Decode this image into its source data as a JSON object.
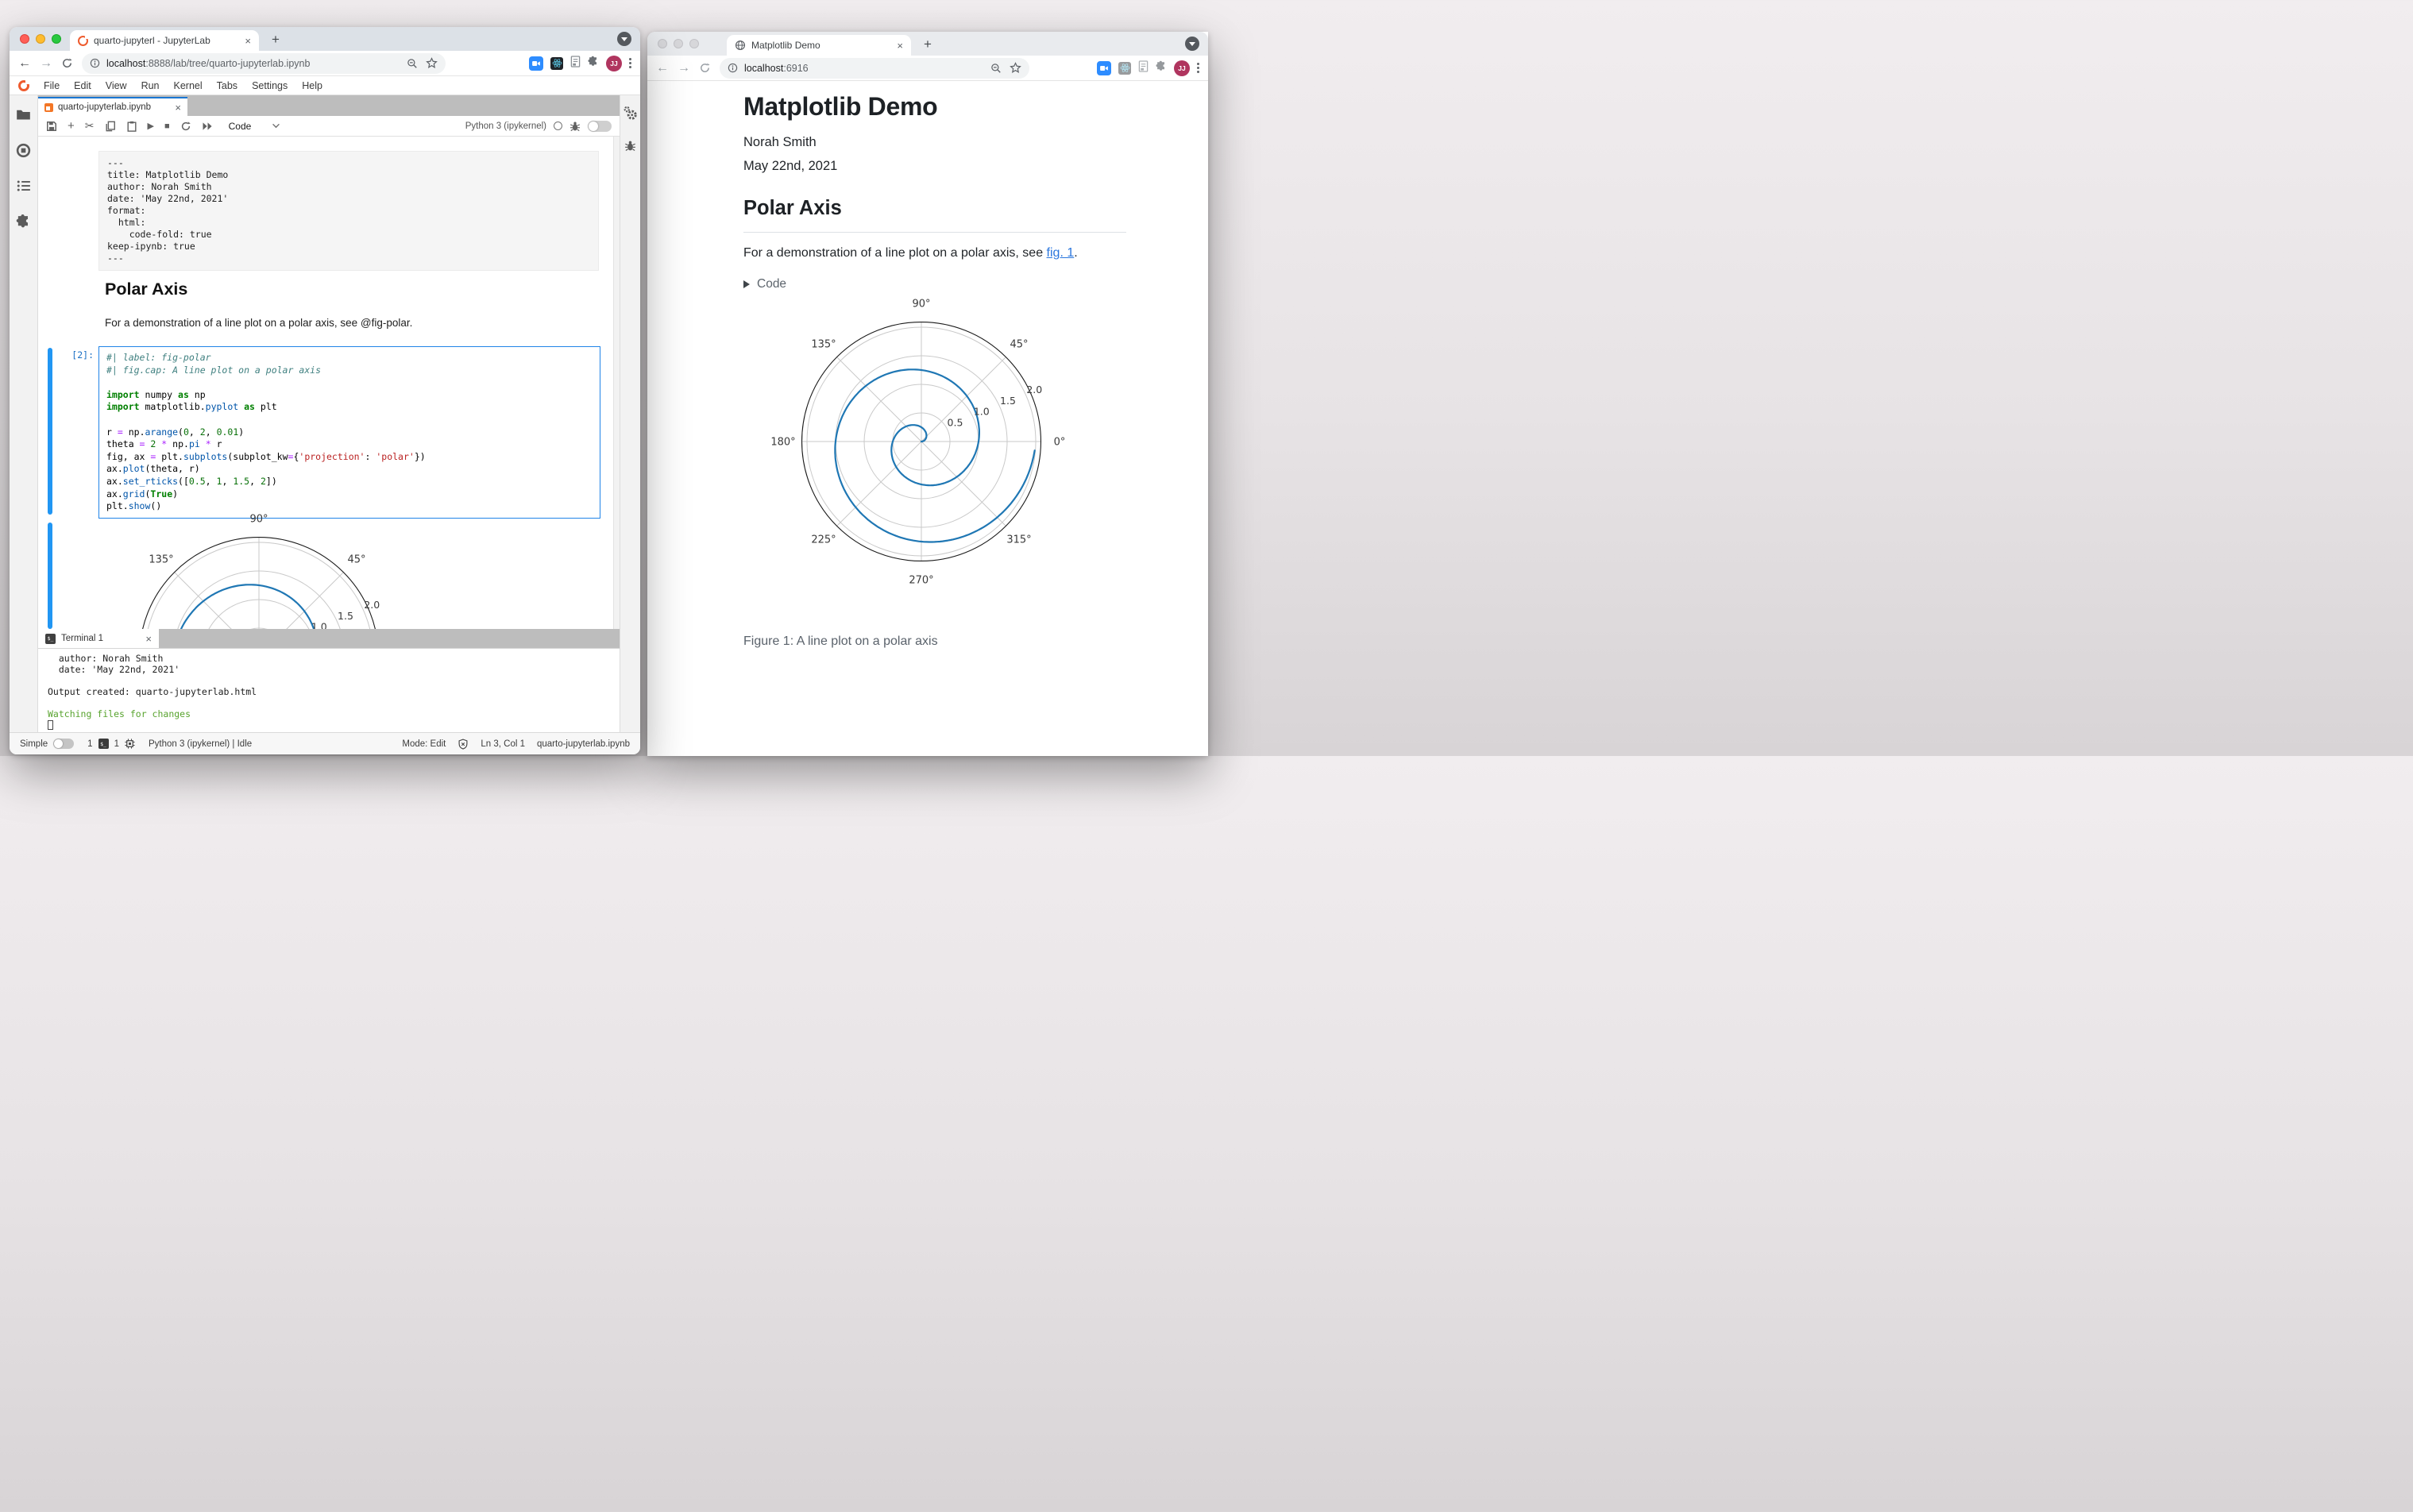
{
  "icons": {
    "close": "×",
    "plus": "+",
    "run": "▶",
    "stop": "■",
    "cut": "✂",
    "ffwd": "▶▶",
    "chevron": "⌄",
    "terminal_glyph": "$_"
  },
  "left_window": {
    "browser": {
      "tab_title": "quarto-jupyterl - JupyterLab",
      "url_host": "localhost",
      "url_path": ":8888/lab/tree/quarto-jupyterlab.ipynb",
      "avatar": "JJ"
    },
    "menu": [
      "File",
      "Edit",
      "View",
      "Run",
      "Kernel",
      "Tabs",
      "Settings",
      "Help"
    ],
    "notebook": {
      "tab_title": "quarto-jupyterlab.ipynb",
      "cell_type": "Code",
      "kernel_label": "Python 3 (ipykernel)",
      "yaml_lines": [
        "---",
        "title: Matplotlib Demo",
        "author: Norah Smith",
        "date: 'May 22nd, 2021'",
        "format:",
        "  html:",
        "    code-fold: true",
        "keep-ipynb: true",
        "---"
      ],
      "md_heading": "Polar Axis",
      "md_paragraph": "For a demonstration of a line plot on a polar axis, see @fig-polar.",
      "execution_count": "[2]:",
      "code_lines": [
        [
          [
            "c",
            "#| label: fig-polar"
          ]
        ],
        [
          [
            "c",
            "#| fig.cap: A line plot on a polar axis"
          ]
        ],
        [],
        [
          [
            "k",
            "import"
          ],
          [
            "p",
            " numpy "
          ],
          [
            "k",
            "as"
          ],
          [
            "p",
            " np"
          ]
        ],
        [
          [
            "k",
            "import"
          ],
          [
            "p",
            " matplotlib."
          ],
          [
            "f",
            "pyplot"
          ],
          [
            "p",
            " "
          ],
          [
            "k",
            "as"
          ],
          [
            "p",
            " plt"
          ]
        ],
        [],
        [
          [
            "p",
            "r "
          ],
          [
            "o",
            "="
          ],
          [
            "p",
            " np."
          ],
          [
            "f",
            "arange"
          ],
          [
            "p",
            "("
          ],
          [
            "n",
            "0"
          ],
          [
            "p",
            ", "
          ],
          [
            "n",
            "2"
          ],
          [
            "p",
            ", "
          ],
          [
            "n",
            "0.01"
          ],
          [
            "p",
            ")"
          ]
        ],
        [
          [
            "p",
            "theta "
          ],
          [
            "o",
            "="
          ],
          [
            "p",
            " "
          ],
          [
            "n",
            "2"
          ],
          [
            "p",
            " "
          ],
          [
            "o",
            "*"
          ],
          [
            "p",
            " np."
          ],
          [
            "f",
            "pi"
          ],
          [
            "p",
            " "
          ],
          [
            "o",
            "*"
          ],
          [
            "p",
            " r"
          ]
        ],
        [
          [
            "p",
            "fig, ax "
          ],
          [
            "o",
            "="
          ],
          [
            "p",
            " plt."
          ],
          [
            "f",
            "subplots"
          ],
          [
            "p",
            "(subplot_kw"
          ],
          [
            "o",
            "="
          ],
          [
            "p",
            "{"
          ],
          [
            "s",
            "'projection'"
          ],
          [
            "p",
            ": "
          ],
          [
            "s",
            "'polar'"
          ],
          [
            "p",
            "})"
          ]
        ],
        [
          [
            "p",
            "ax."
          ],
          [
            "f",
            "plot"
          ],
          [
            "p",
            "(theta, r)"
          ]
        ],
        [
          [
            "p",
            "ax."
          ],
          [
            "f",
            "set_rticks"
          ],
          [
            "p",
            "(["
          ],
          [
            "n",
            "0.5"
          ],
          [
            "p",
            ", "
          ],
          [
            "n",
            "1"
          ],
          [
            "p",
            ", "
          ],
          [
            "n",
            "1.5"
          ],
          [
            "p",
            ", "
          ],
          [
            "n",
            "2"
          ],
          [
            "p",
            "])"
          ]
        ],
        [
          [
            "p",
            "ax."
          ],
          [
            "f",
            "grid"
          ],
          [
            "p",
            "("
          ],
          [
            "k",
            "True"
          ],
          [
            "p",
            ")"
          ]
        ],
        [
          [
            "p",
            "plt."
          ],
          [
            "f",
            "show"
          ],
          [
            "p",
            "()"
          ]
        ]
      ]
    },
    "terminal": {
      "tab_title": "Terminal 1",
      "lines": [
        {
          "t": "  author: Norah Smith"
        },
        {
          "t": "  date: 'May 22nd, 2021'"
        },
        {
          "t": ""
        },
        {
          "t": "Output created: quarto-jupyterlab.html"
        },
        {
          "t": ""
        },
        {
          "t": "Watching files for changes",
          "c": "green"
        }
      ]
    },
    "statusbar": {
      "simple": "Simple",
      "terminals": "1",
      "kernels": "1",
      "kernel_status": "Python 3 (ipykernel) | Idle",
      "mode": "Mode: Edit",
      "cursor_pos": "Ln 3, Col 1",
      "filename": "quarto-jupyterlab.ipynb"
    }
  },
  "right_window": {
    "browser": {
      "tab_title": "Matplotlib Demo",
      "url_host": "localhost",
      "url_path": ":6916",
      "avatar": "JJ"
    },
    "page": {
      "title": "Matplotlib Demo",
      "author": "Norah Smith",
      "date": "May 22nd, 2021",
      "section_heading": "Polar Axis",
      "para_prefix": "For a demonstration of a line plot on a polar axis, see ",
      "link_text": "fig. 1",
      "para_suffix": ".",
      "code_summary": "Code",
      "figure_caption": "Figure 1: A line plot on a polar axis"
    }
  },
  "chart_data": {
    "type": "line",
    "projection": "polar",
    "series": [
      {
        "name": "spiral",
        "r_formula": "r = theta / (2*pi)",
        "theta_deg_range": [
          0,
          716.4
        ],
        "r_range": [
          0,
          1.99
        ]
      }
    ],
    "r_ticks": [
      0.5,
      1.0,
      1.5,
      2.0
    ],
    "r_tick_labels": [
      "0.5",
      "1.0",
      "1.5",
      "2.0"
    ],
    "r_label_angle_deg": 22.5,
    "theta_ticks_deg": [
      0,
      45,
      90,
      135,
      180,
      225,
      270,
      315
    ],
    "theta_tick_labels": [
      "0°",
      "45°",
      "90°",
      "135°",
      "180°",
      "225°",
      "270°",
      "315°"
    ],
    "r_max_display": 2.09,
    "grid": true,
    "line_color": "#1f77b4",
    "grid_color": "#c9c9c9",
    "spine_color": "#1a1a1a",
    "label_color": "#3a3a3a"
  }
}
